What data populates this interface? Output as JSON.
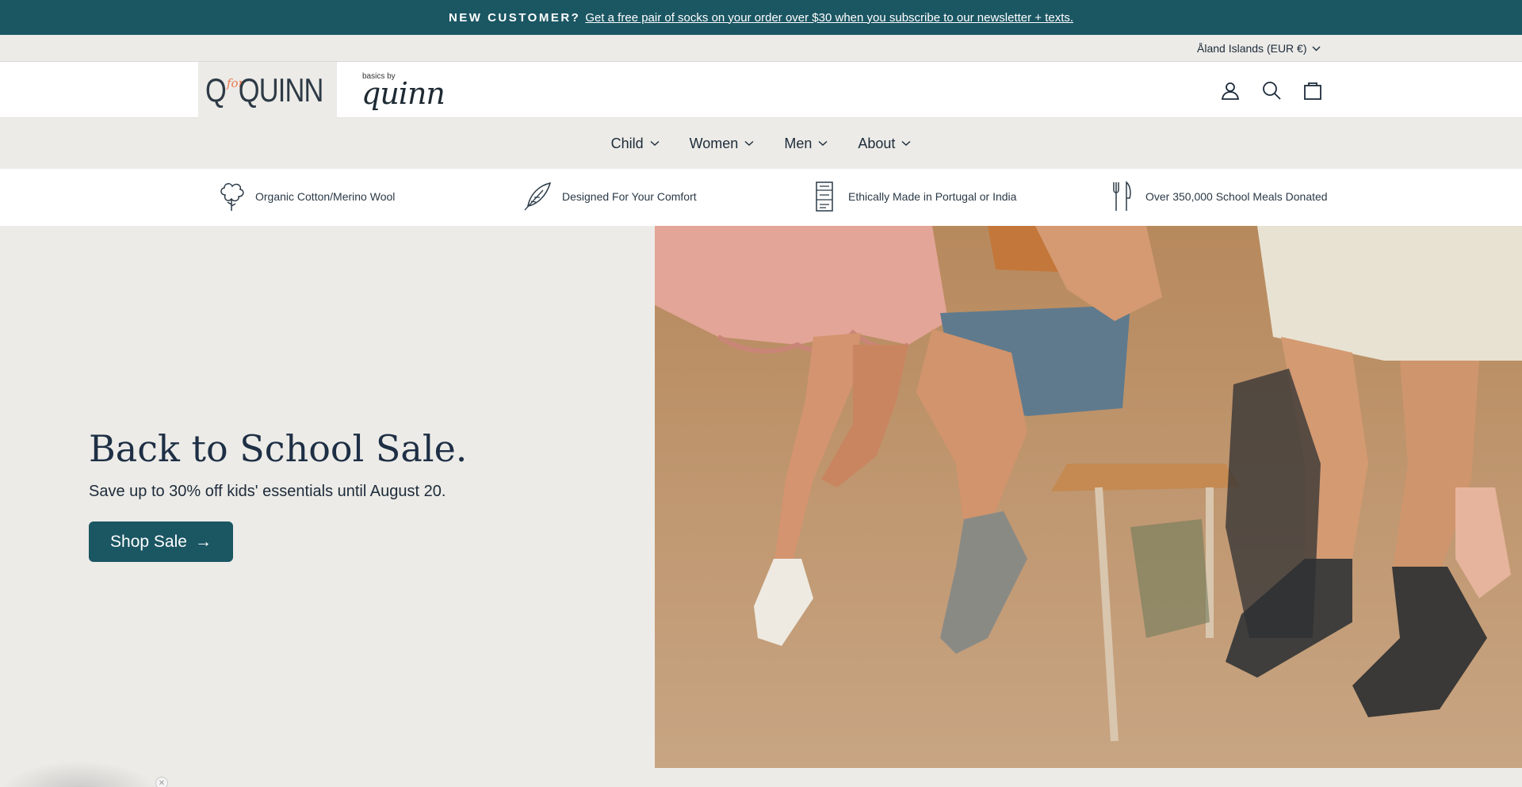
{
  "announcement": {
    "lead": "NEW CUSTOMER?",
    "link_text": "Get a free pair of socks on your order over $30 when you subscribe to our newsletter + texts."
  },
  "utility_bar": {
    "locale": "Åland Islands (EUR €)"
  },
  "header": {
    "logo_primary": "Q for QUINN",
    "logo_primary_word": "QUINN",
    "logo_primary_for": "for",
    "logo_secondary_small": "basics by",
    "logo_secondary_script": "quinn",
    "icons": [
      "account-icon",
      "search-icon",
      "cart-icon"
    ]
  },
  "nav": {
    "items": [
      {
        "label": "Child"
      },
      {
        "label": "Women"
      },
      {
        "label": "Men"
      },
      {
        "label": "About"
      }
    ]
  },
  "features": [
    {
      "label": "Organic Cotton/Merino Wool",
      "icon": "cotton-icon"
    },
    {
      "label": "Designed For Your Comfort",
      "icon": "feather-icon"
    },
    {
      "label": "Ethically Made in Portugal or India",
      "icon": "label-tag-icon"
    },
    {
      "label": "Over 350,000 School Meals Donated",
      "icon": "fork-knife-icon"
    }
  ],
  "hero": {
    "title": "Back to School Sale.",
    "subtitle": "Save up to 30% off kids' essentials until August 20.",
    "button_label": "Shop Sale",
    "button_arrow": "→"
  },
  "colors": {
    "brand_teal": "#1b5663",
    "background": "#ecebe7",
    "text_dark": "#1d2b3a",
    "accent_orange": "#e9784f"
  }
}
